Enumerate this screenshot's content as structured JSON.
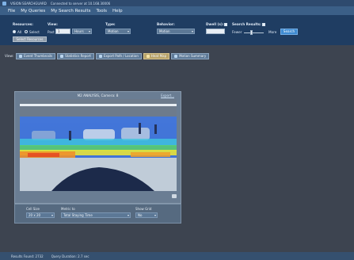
{
  "window": {
    "title": "VISION SEARCHGUARD",
    "status": "Connected to server at 10.168.30006"
  },
  "menu": [
    "File",
    "My Queries",
    "My Search Results",
    "Tools",
    "Help"
  ],
  "toolbar": {
    "resources_label": "Resources:",
    "all_label": "All",
    "select_label": "Select",
    "select_resources_button": "Select Resources",
    "view_label": "View:",
    "past_label": "Past",
    "past_value": "1",
    "period_value": "Hours",
    "type_label": "Type:",
    "type_value": "Motion",
    "behavior_label": "Behavior:",
    "behavior_value": "Motion",
    "dwell_label": "Dwell (s):",
    "search_results_label": "Search Results:",
    "fewer_label": "Fewer",
    "more_label": "More",
    "search_button": "Search"
  },
  "viewbar": {
    "label": "View:",
    "buttons": [
      {
        "label": "Event Thumbnails",
        "active": false
      },
      {
        "label": "Statistics Report",
        "active": false
      },
      {
        "label": "Export Path / Location",
        "active": false
      },
      {
        "label": "Heat Map",
        "active": true
      },
      {
        "label": "Motion Summary",
        "active": false
      }
    ]
  },
  "panel": {
    "title": "M2 ANALYSIS, Camera: 8",
    "link": "Export..."
  },
  "controls": {
    "cell_size_label": "Cell Size",
    "cell_size_value": "20 x 20",
    "metric_label": "Metric to",
    "metric_value": "Total Staying Time",
    "show_grid_label": "Show Grid",
    "show_grid_value": "No"
  },
  "statusbar": {
    "results": "Results Found: 2732",
    "duration": "Query Duration: 2.7 sec"
  },
  "colors": {
    "background": "#3d4450",
    "toolbar": "#1f3d62",
    "menubar": "#3b5f87",
    "accent": "#3f8bd1",
    "active_view": "#b8a36a"
  }
}
